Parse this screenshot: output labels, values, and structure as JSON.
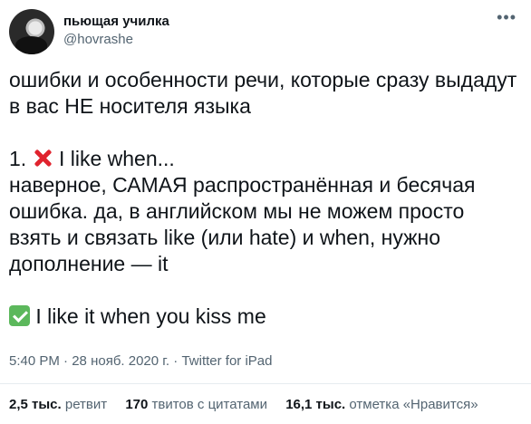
{
  "author": {
    "display_name": "пьющая училка",
    "handle": "@hovrashe"
  },
  "tweet": {
    "p1": "ошибки и особенности речи, которые сразу выдадут в вас НЕ носителя языка",
    "item1_prefix": "1.",
    "item1_icon": "red-cross-mark-icon",
    "item1_title": "I like when...",
    "item1_body": "наверное, САМАЯ распространённая и бесячая ошибка. да, в английском мы не можем просто взять и связать like (или hate) и when, нужно дополнение — it",
    "fix_icon": "green-check-mark-icon",
    "fix_text": "I like it when you kiss me"
  },
  "meta": {
    "time": "5:40 PM",
    "sep1": "·",
    "date": "28 нояб. 2020 г.",
    "sep2": "·",
    "source": "Twitter for iPad"
  },
  "stats": {
    "retweets_count": "2,5 тыс.",
    "retweets_label": "ретвит",
    "quotes_count": "170",
    "quotes_label": "твитов с цитатами",
    "likes_count": "16,1 тыс.",
    "likes_label": "отметка «Нравится»"
  },
  "colors": {
    "text": "#0f1419",
    "secondary": "#536471",
    "divider": "#e6ecf0",
    "cross": "#e0232e",
    "check": "#5cb85c"
  }
}
